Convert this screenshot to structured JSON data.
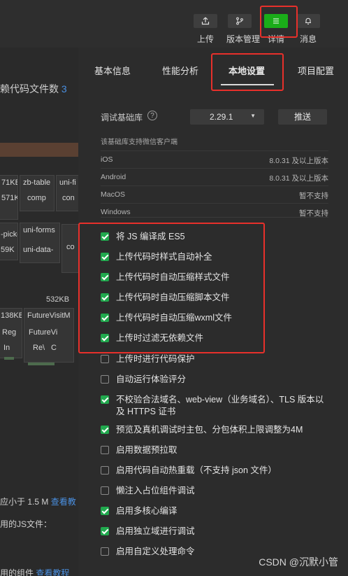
{
  "toolbar": {
    "buttons": [
      {
        "label": "上传",
        "icon": "upload-icon"
      },
      {
        "label": "版本管理",
        "icon": "branch-icon"
      },
      {
        "label": "详情",
        "icon": "menu-icon"
      },
      {
        "label": "消息",
        "icon": "bell-icon"
      }
    ]
  },
  "background": {
    "line1_text": "赖代码文件数",
    "line1_num": "3",
    "cells": [
      "71KB",
      "zb-table",
      "uni-fi",
      "571KB",
      "comp",
      "con",
      "-picke",
      "uni-forms",
      "59K",
      "uni-data-",
      "co",
      "532KB",
      "138KB",
      "FutureVisitM",
      "Reg",
      "FutureVi",
      "In",
      "Re\\",
      "C"
    ],
    "bottom1_text": "应小于 1.5 M",
    "bottom1_link": "查看教",
    "bottom2_text": "用的JS文件：",
    "bottom3_text": "用的组件",
    "bottom3_link": "查看教程"
  },
  "tabs": [
    "基本信息",
    "性能分析",
    "本地设置",
    "项目配置"
  ],
  "active_tab": "本地设置",
  "debug_lib": {
    "label": "调试基础库",
    "help_glyph": "?",
    "version": "2.29.1",
    "push_label": "推送"
  },
  "support": {
    "title": "该基础库支持微信客户端",
    "rows": [
      {
        "platform": "iOS",
        "value": "8.0.31 及以上版本"
      },
      {
        "platform": "Android",
        "value": "8.0.31 及以上版本"
      },
      {
        "platform": "MacOS",
        "value": "暂不支持"
      },
      {
        "platform": "Windows",
        "value": "暂不支持"
      }
    ]
  },
  "options": [
    {
      "label": "将 JS 编译成 ES5",
      "checked": true
    },
    {
      "label": "上传代码时样式自动补全",
      "checked": true
    },
    {
      "label": "上传代码时自动压缩样式文件",
      "checked": true
    },
    {
      "label": "上传代码时自动压缩脚本文件",
      "checked": true
    },
    {
      "label": "上传代码时自动压缩wxml文件",
      "checked": true
    },
    {
      "label": "上传时过滤无依赖文件",
      "checked": true
    },
    {
      "label": "上传时进行代码保护",
      "checked": false
    },
    {
      "label": "自动运行体验评分",
      "checked": false
    },
    {
      "label": "不校验合法域名、web-view（业务域名）、TLS 版本以及 HTTPS 证书",
      "checked": true
    },
    {
      "label": "预览及真机调试时主包、分包体积上限调整为4M",
      "checked": true
    },
    {
      "label": "启用数据预拉取",
      "checked": false
    },
    {
      "label": "启用代码自动热重载（不支持 json 文件）",
      "checked": false
    },
    {
      "label": "懒注入占位组件调试",
      "checked": false
    },
    {
      "label": "启用多核心编译",
      "checked": true
    },
    {
      "label": "启用独立域进行调试",
      "checked": true
    },
    {
      "label": "启用自定义处理命令",
      "checked": false
    }
  ],
  "watermark": "CSDN @沉默小管",
  "colors": {
    "accent_green": "#1aad19",
    "checkbox_green": "#21a94e",
    "highlight_red": "#e8302b",
    "link_blue": "#4a90e2"
  }
}
